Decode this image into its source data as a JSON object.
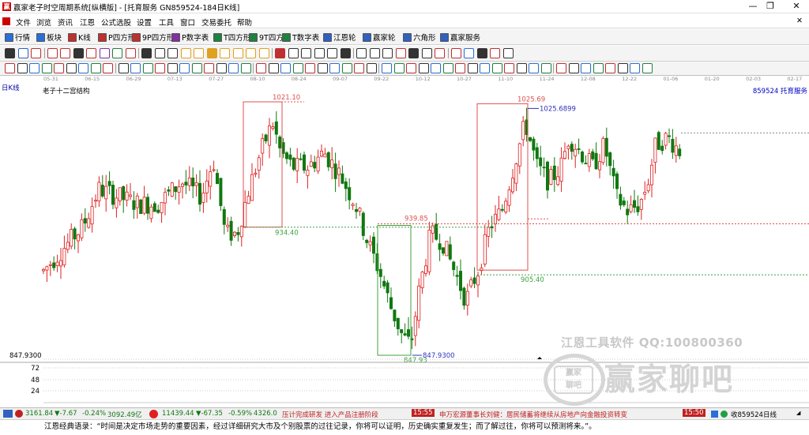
{
  "window": {
    "icon_label": "赢",
    "title": "赢家老子时空周期系统[纵横版] - [托育服务  GN859524-184日K线]",
    "buttons": [
      "—",
      "❐",
      "✕"
    ]
  },
  "menu": {
    "close_label": "✕",
    "items": [
      "文件",
      "浏览",
      "资讯",
      "江恩",
      "公式选股",
      "设置",
      "工具",
      "窗口",
      "交易委托",
      "帮助"
    ]
  },
  "toolbar1": {
    "items": [
      {
        "label": "行情",
        "icon": "grid-icon",
        "color": "#2a6fd6"
      },
      {
        "label": "板块",
        "icon": "blocks-icon",
        "color": "#2a6fd6"
      },
      {
        "label": "K线",
        "icon": "kline-icon",
        "color": "#c03030"
      },
      {
        "label": "P四方形",
        "icon": "p-square-icon",
        "color": "#c03030"
      },
      {
        "label": "9P四方形",
        "icon": "9p-square-icon",
        "color": "#c03030"
      },
      {
        "label": "P数字表",
        "icon": "p-table-icon",
        "color": "#8030a0"
      },
      {
        "label": "T四方形",
        "icon": "t-square-icon",
        "color": "#208040"
      },
      {
        "label": "9T四方形",
        "icon": "9t-square-icon",
        "color": "#208040"
      },
      {
        "label": "T数字表",
        "icon": "t-table-icon",
        "color": "#208040"
      },
      {
        "label": "江恩轮",
        "icon": "gann-wheel-icon",
        "color": "#3060c0"
      },
      {
        "label": "赢家轮",
        "icon": "winner-wheel-icon",
        "color": "#3060c0"
      },
      {
        "label": "六角形",
        "icon": "hexagon-icon",
        "color": "#3060c0"
      },
      {
        "label": "赢家服务",
        "icon": "service-icon",
        "color": "#3060c0"
      }
    ]
  },
  "chart_header": {
    "period": "日K线",
    "indicator": "老子十二宫结构",
    "code_name": "859524 托育服务"
  },
  "date_axis": [
    "05-31",
    "06-15",
    "06-29",
    "07-13",
    "07-27",
    "08-10",
    "08-24",
    "09-07",
    "09-22",
    "10-12",
    "10-27",
    "11-10",
    "11-24",
    "12-08",
    "12-22",
    "01-06",
    "01-20",
    "02-03",
    "02-17"
  ],
  "price_labels": {
    "high1": "1021.10",
    "low1": "934.40",
    "box_mid": "939.85",
    "low_point": "847.93",
    "low_point_precise": "847.9300",
    "high2": "1025.69",
    "high2_precise": "1025.6899",
    "low2": "905.40",
    "axis_low": "847.9300"
  },
  "volume_axis": [
    "72",
    "48",
    "24"
  ],
  "colors": {
    "up": "#e02020",
    "down": "#107810",
    "box_red": "#e05050",
    "box_green": "#40a040",
    "line_blue": "#3030c0"
  },
  "watermark": {
    "line1": "江恩工具软件  QQ:100800360",
    "logo_text": "赢家\n聊吧",
    "line2": "赢家聊吧"
  },
  "statusbar": {
    "sh_index": "3161.84",
    "sh_change": "▼-7.67",
    "sh_pct": "-0.24%",
    "sh_amount": "3092.49亿",
    "sz_index": "11439.44",
    "sz_change": "▼-67.35",
    "sz_pct": "-0.59%",
    "sz_amount": "4326.0",
    "news1": "压计完成研发 进入产品注册阶段",
    "time1": "15:55",
    "news2": "申万宏源董事长刘健：居民储蓄将继续从房地产向金融投资转变",
    "time2": "15:50",
    "right_label": "收859524日线"
  },
  "footer": {
    "quote": "江恩经典语录：“时间是决定市场走势的重要因素，经过详细研究大市及个别股票的过往记录，你将可以证明，历史确实重复发生；而了解过往，你将可以预测将来。”。"
  }
}
